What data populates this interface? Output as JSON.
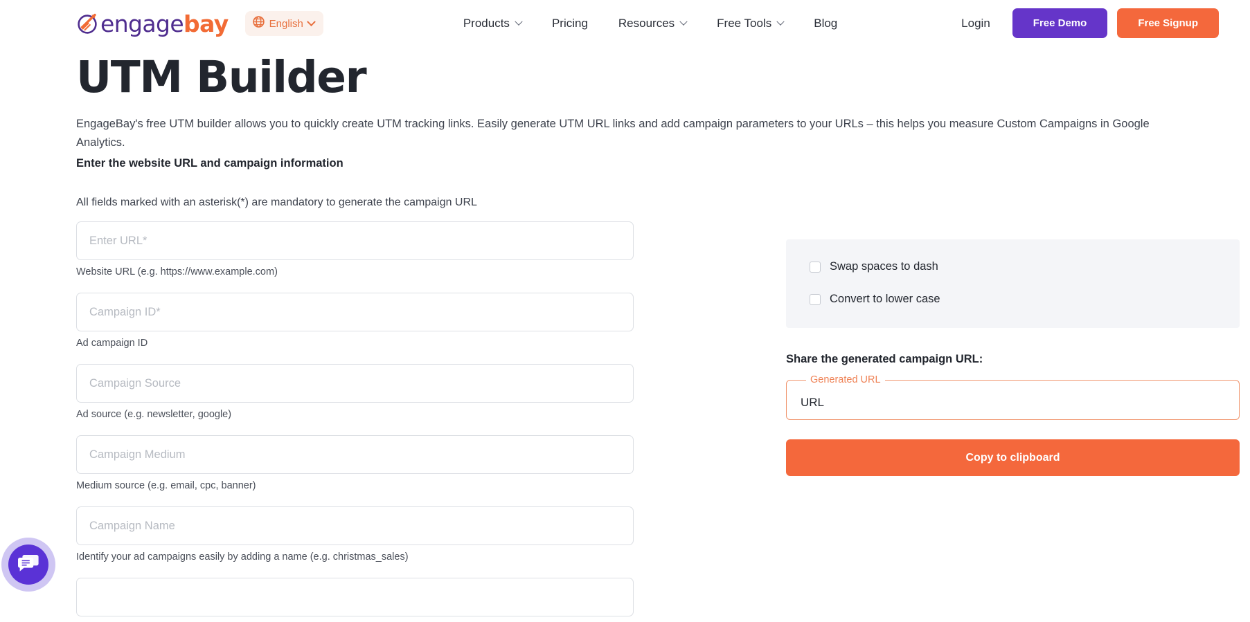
{
  "header": {
    "brand": {
      "icon": "engagebay-logo-icon",
      "text_part1": "engage",
      "text_part2": "bay"
    },
    "language": {
      "icon": "globe-icon",
      "label": "English",
      "chevron": "chevron-down-icon"
    },
    "nav": [
      {
        "label": "Products",
        "has_dropdown": true
      },
      {
        "label": "Pricing",
        "has_dropdown": false
      },
      {
        "label": "Resources",
        "has_dropdown": true
      },
      {
        "label": "Free Tools",
        "has_dropdown": true
      },
      {
        "label": "Blog",
        "has_dropdown": false
      }
    ],
    "login_label": "Login",
    "demo_label": "Free Demo",
    "signup_label": "Free Signup",
    "demo_color": "#6535c9",
    "signup_color": "#f4683c"
  },
  "main": {
    "title": "UTM Builder",
    "intro": "EngageBay's free UTM builder allows you to quickly create UTM tracking links. Easily generate UTM URL links and add campaign parameters to your URLs – this helps you measure Custom Campaigns in Google Analytics.",
    "intro_strong": "Enter the website URL and campaign information",
    "mandatory_note": "All fields marked with an asterisk(*) are mandatory to generate the campaign URL",
    "fields": [
      {
        "name": "url",
        "placeholder": "Enter URL*",
        "value": "",
        "help": "Website URL (e.g. https://www.example.com)"
      },
      {
        "name": "campaign-id",
        "placeholder": "Campaign ID*",
        "value": "",
        "help": "Ad campaign ID"
      },
      {
        "name": "campaign-source",
        "placeholder": "Campaign Source",
        "value": "",
        "help": "Ad source (e.g. newsletter, google)"
      },
      {
        "name": "campaign-medium",
        "placeholder": "Campaign Medium",
        "value": "",
        "help": "Medium source (e.g. email, cpc, banner)"
      },
      {
        "name": "campaign-name",
        "placeholder": "Campaign Name",
        "value": "",
        "help": "Identify your ad campaigns easily by adding a name (e.g. christmas_sales)"
      },
      {
        "name": "campaign-term",
        "placeholder": "",
        "value": "",
        "help": ""
      }
    ],
    "options": [
      {
        "label": "Swap spaces to dash",
        "checked": false
      },
      {
        "label": "Convert to lower case",
        "checked": false
      }
    ],
    "share_label": "Share the generated campaign URL:",
    "generated": {
      "legend": "Generated URL",
      "value": "URL",
      "border_color": "#f0936b"
    },
    "copy_label": "Copy to clipboard"
  },
  "chat": {
    "icon": "chat-bubble-icon",
    "color": "#5a32d6"
  }
}
